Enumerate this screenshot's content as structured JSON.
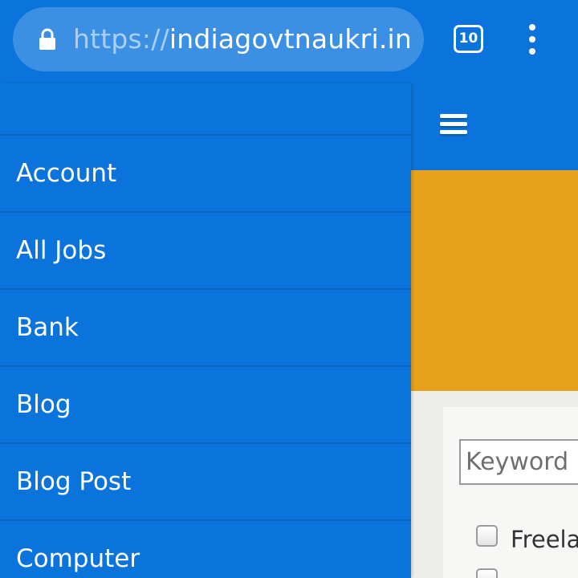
{
  "browser": {
    "url_scheme": "https://",
    "url_host": "indiagovtnaukri.in",
    "tab_count": "10",
    "icons": {
      "lock": "lock-icon",
      "tabs": "tabs-icon",
      "more": "more-vert-icon"
    }
  },
  "header": {
    "menu_icon": "hamburger-icon"
  },
  "menu": {
    "items": [
      {
        "label": "Account"
      },
      {
        "label": "All Jobs"
      },
      {
        "label": "Bank"
      },
      {
        "label": "Blog"
      },
      {
        "label": "Blog Post"
      },
      {
        "label": "Computer"
      }
    ]
  },
  "search": {
    "keyword_placeholder": "Keyword",
    "checkbox_label": "Freela"
  },
  "colors": {
    "primary": "#0b74dc",
    "banner": "#e6a21d",
    "url_bar": "#3b90e4"
  }
}
